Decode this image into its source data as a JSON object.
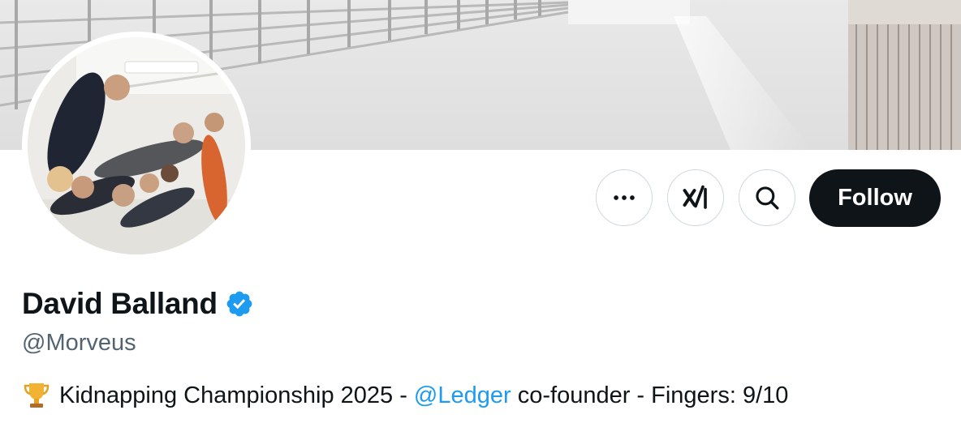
{
  "profile": {
    "display_name": "David Balland",
    "handle": "@Morveus",
    "verified": true,
    "bio": {
      "emoji": "trophy-icon",
      "text_before": "Kidnapping Championship 2025 - ",
      "mention": "@Ledger",
      "text_after": " co-founder - Fingers: 9/10"
    }
  },
  "actions": {
    "more_icon": "more-dots-icon",
    "grok_icon": "xai-grok-icon",
    "search_icon": "search-icon",
    "follow_label": "Follow"
  },
  "colors": {
    "accent": "#1d9bf0",
    "follow_bg": "#0f1419",
    "secondary_text": "#536471",
    "border": "#cfd9de"
  }
}
